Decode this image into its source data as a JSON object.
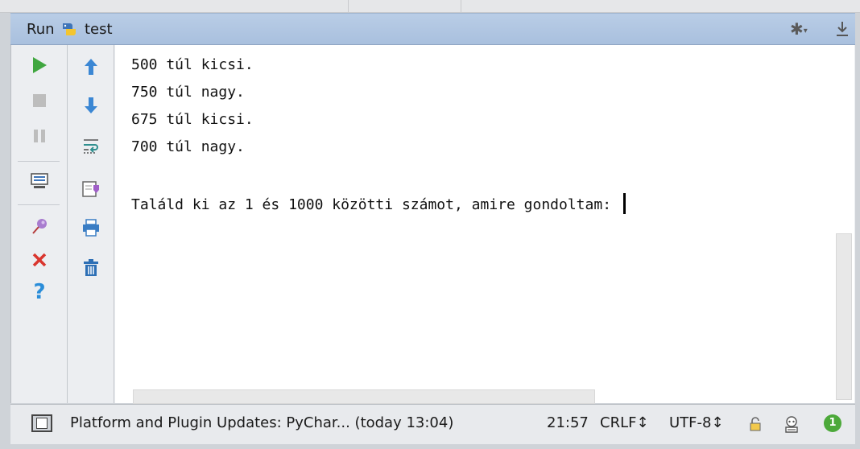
{
  "toolwindow": {
    "run_label": "Run",
    "config_name": "test",
    "python_icon": "python-icon",
    "settings_icon": "gear-icon",
    "hide_icon": "hide-down-icon"
  },
  "left_toolbar": {
    "col1": [
      "run-icon",
      "stop-icon",
      "pause-icon",
      "layout-icon",
      "pin-icon",
      "close-icon",
      "help-icon"
    ],
    "col2": [
      "up-arrow-icon",
      "down-arrow-icon",
      "soft-wrap-icon",
      "scroll-to-end-icon",
      "print-icon",
      "trash-icon"
    ]
  },
  "console": {
    "lines": [
      "500 túl kicsi.",
      "750 túl nagy.",
      "675 túl kicsi.",
      "700 túl nagy.",
      "",
      "Találd ki az 1 és 1000 közötti számot, amire gondoltam: "
    ]
  },
  "statusbar": {
    "message": "Platform and Plugin Updates: PyChar... (today 13:04)",
    "position": "21:57",
    "line_sep": "CRLF↕",
    "encoding": "UTF-8↕",
    "notifications": "1"
  },
  "colors": {
    "run_green": "#3fa63f",
    "close_red": "#d9352e",
    "help_blue": "#2a8dd9",
    "badge_green": "#4ca93a",
    "titlebar_blue": "#b3c8e3"
  }
}
